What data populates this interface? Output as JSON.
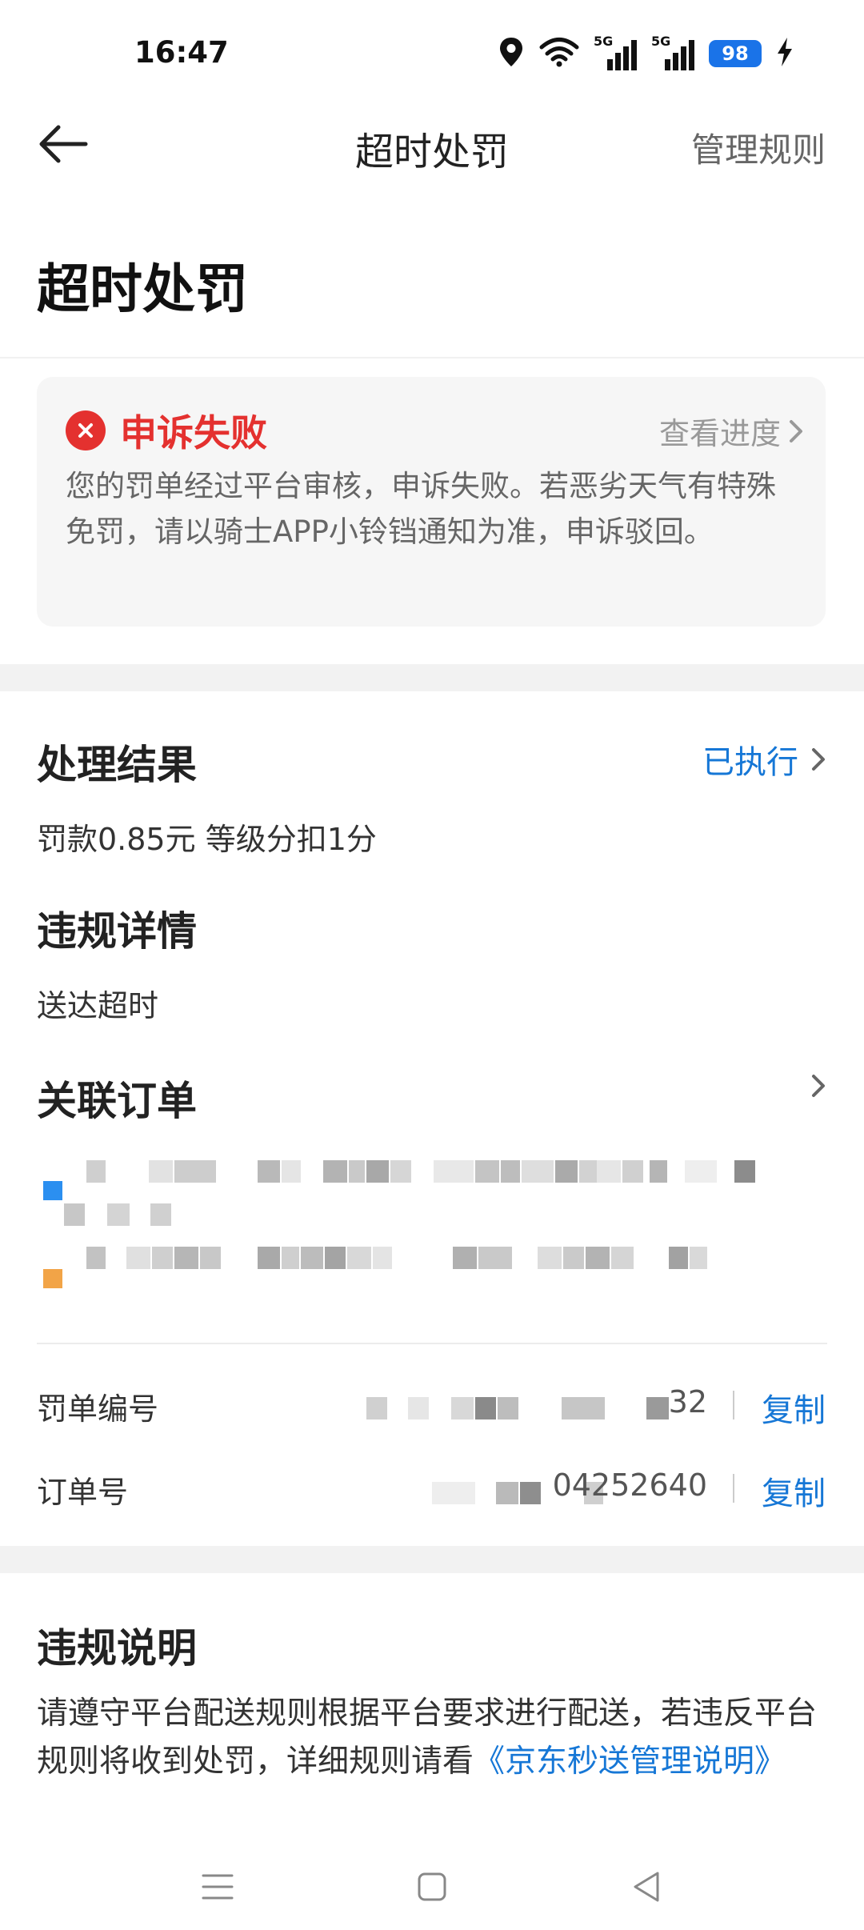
{
  "status_bar": {
    "time": "16:47",
    "network_label_1": "5G",
    "network_label_2": "5G",
    "battery": "98",
    "icons": [
      "location-icon",
      "wifi-icon",
      "signal-5g-icon",
      "signal-5g-icon",
      "battery-icon",
      "charging-icon"
    ]
  },
  "navbar": {
    "title": "超时处罚",
    "right_action": "管理规则",
    "back_icon": "arrow-left-icon"
  },
  "page_heading": "超时处罚",
  "appeal": {
    "status": "申诉失败",
    "status_color": "#e4312f",
    "progress_link": "查看进度",
    "description": "您的罚单经过平台审核，申诉失败。若恶劣天气有特殊免罚，请以骑士APP小铃铛通知为准，申诉驳回。"
  },
  "result": {
    "title": "处理结果",
    "status_link": "已执行",
    "detail": "罚款0.85元 等级分扣1分"
  },
  "violation": {
    "title": "违规详情",
    "detail": "送达超时"
  },
  "linked_order": {
    "title": "关联订单",
    "pickup_marker_color": "#2b8ff0",
    "dropoff_marker_color": "#f2a447"
  },
  "ticket": {
    "label": "罚单编号",
    "value_visible": "32",
    "copy": "复制"
  },
  "order": {
    "label": "订单号",
    "value_visible": "04252640",
    "copy": "复制"
  },
  "rules": {
    "title": "违规说明",
    "description": "请遵守平台配送规则根据平台要求进行配送，若违反平台规则将收到处罚，详细规则请看",
    "link": "《京东秒送管理说明》"
  },
  "accent_color": "#1677d6",
  "system_nav": [
    "menu-icon",
    "home-icon",
    "back-triangle-icon"
  ]
}
